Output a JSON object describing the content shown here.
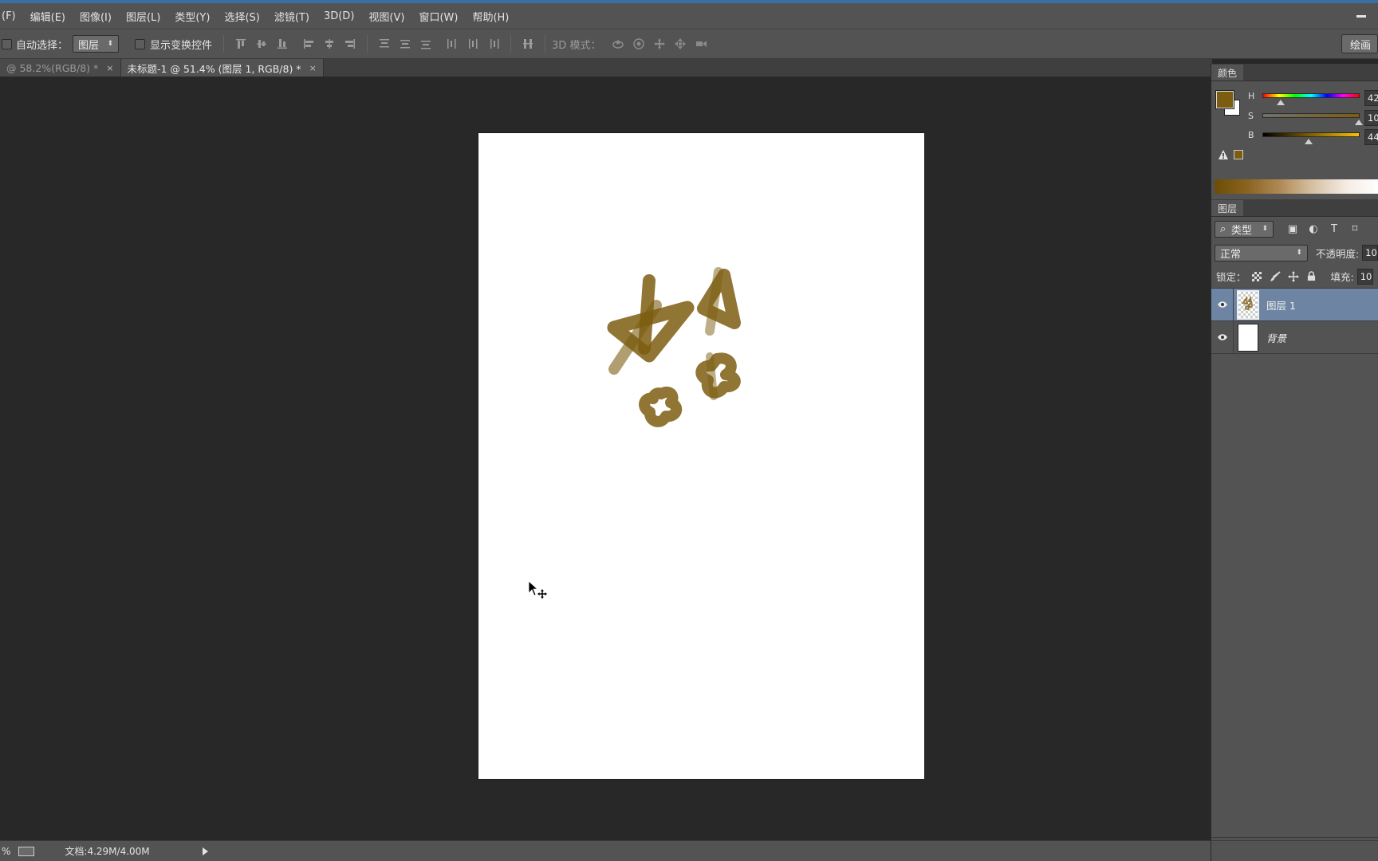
{
  "menubar": {
    "items": [
      "(F)",
      "编辑(E)",
      "图像(I)",
      "图层(L)",
      "类型(Y)",
      "选择(S)",
      "滤镜(T)",
      "3D(D)",
      "视图(V)",
      "窗口(W)",
      "帮助(H)"
    ]
  },
  "options": {
    "auto_select_label": "自动选择：",
    "auto_select_value": "图层",
    "show_transform_label": "显示变换控件",
    "mode3d_label": "3D 模式：",
    "paint_button": "绘画"
  },
  "tabs": [
    {
      "label": "@ 58.2%(RGB/8) *",
      "close": "×",
      "active": false
    },
    {
      "label": "未标题-1 @ 51.4% (图层 1, RGB/8) *",
      "close": "×",
      "active": true
    }
  ],
  "color_panel": {
    "title": "颜色",
    "foreground": "#7c5d10",
    "background": "#ffffff",
    "sliders": [
      {
        "label": "H",
        "value": "42",
        "position": 0.11
      },
      {
        "label": "S",
        "value": "10",
        "position": 0.98
      },
      {
        "label": "B",
        "value": "44",
        "position": 0.42
      }
    ]
  },
  "layers_panel": {
    "title": "图层",
    "filter_value": "类型",
    "filter_icon": "search-icon",
    "blend_mode": "正常",
    "opacity_label": "不透明度:",
    "opacity_value": "10",
    "lock_label": "锁定：",
    "fill_label": "填充:",
    "fill_value": "10",
    "layers": [
      {
        "name": "图层 1",
        "selected": true,
        "italic": false,
        "thumbnail": "checker"
      },
      {
        "name": "背景",
        "selected": false,
        "italic": true,
        "thumbnail": "white"
      }
    ]
  },
  "statusbar": {
    "zoom": "%",
    "doc_info": "文档:4.29M/4.00M"
  },
  "colors": {
    "brush": "#7c5d10",
    "selection": "#6d85a3",
    "ui_panel": "#535353",
    "canvas_bg": "#282828"
  }
}
